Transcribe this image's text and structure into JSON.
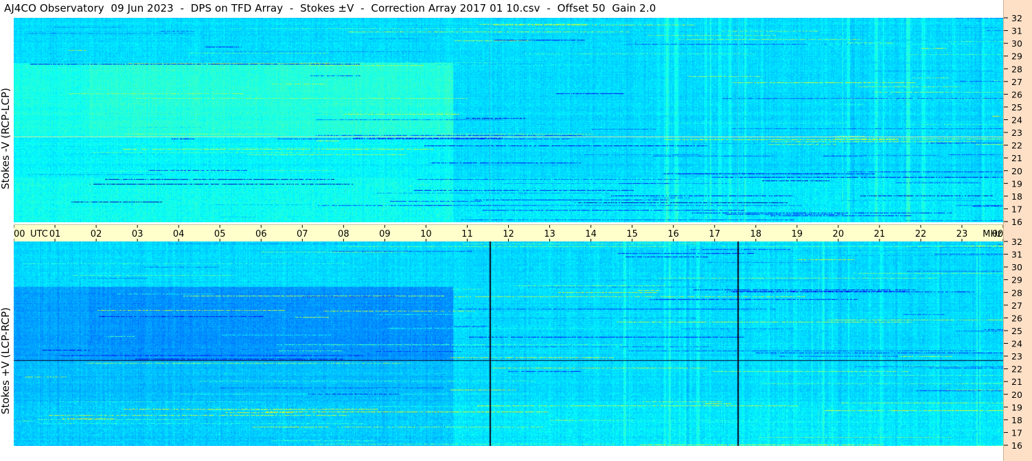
{
  "title": "AJ4CO Observatory  09 Jun 2023  -  DPS on TFD Array  -  Stokes ±V  -  Correction Array 2017 01 10.csv  -  Offset 50  Gain 2.0",
  "colors": {
    "background_top": "#1a5fd8",
    "background_bottom": "#1a66dd",
    "time_band": "#ffffcc",
    "freq_strip": "#fde0c6"
  },
  "chart_data": [
    {
      "type": "heatmap",
      "name": "top-panel",
      "ylabel": "Stokes -V (RCP-LCP)",
      "x_unit": "UTC hour",
      "xlim": [
        0,
        24
      ],
      "y_unit": "MHz",
      "ylim": [
        16,
        32
      ],
      "colormap": [
        "#00007f",
        "#0000ff",
        "#007fff",
        "#00ffff",
        "#7fff7f",
        "#ffff00",
        "#ff7f00"
      ]
    },
    {
      "type": "heatmap",
      "name": "bottom-panel",
      "ylabel": "Stokes +V (LCP-RCP)",
      "x_unit": "UTC hour",
      "xlim": [
        0,
        24
      ],
      "y_unit": "MHz",
      "ylim": [
        16,
        32
      ],
      "colormap": [
        "#00007f",
        "#0000ff",
        "#007fff",
        "#00ffff",
        "#7fff7f",
        "#ffff00",
        "#ff7f00"
      ]
    }
  ],
  "time_axis": {
    "ticks": [
      "00",
      "01",
      "02",
      "03",
      "04",
      "05",
      "06",
      "07",
      "08",
      "09",
      "10",
      "11",
      "12",
      "13",
      "14",
      "15",
      "16",
      "17",
      "18",
      "19",
      "20",
      "21",
      "22",
      "23",
      "00"
    ],
    "utc_label": "UTC",
    "unit_label": "MHz"
  },
  "freq_axis": {
    "ticks": [
      "32",
      "31",
      "30",
      "29",
      "28",
      "27",
      "26",
      "25",
      "24",
      "23",
      "22",
      "21",
      "20",
      "19",
      "18",
      "17",
      "16"
    ]
  }
}
